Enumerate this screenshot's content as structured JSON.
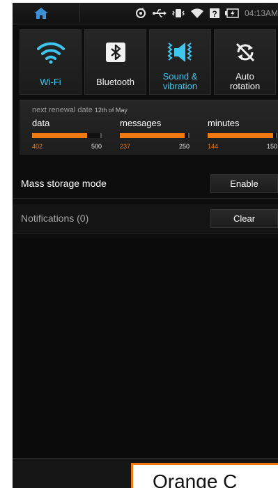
{
  "status_bar": {
    "time": "04:13AM",
    "icons": [
      "home-icon",
      "sync-icon",
      "usb-icon",
      "vibrate-icon",
      "wifi-signal-icon",
      "unknown-network-icon",
      "battery-icon"
    ]
  },
  "quick_settings": [
    {
      "label": "Wi-Fi",
      "icon": "wifi-icon",
      "active": true
    },
    {
      "label": "Bluetooth",
      "icon": "bluetooth-icon",
      "active": false
    },
    {
      "label": "Sound &\nvibration",
      "icon": "speaker-icon",
      "active": true
    },
    {
      "label": "Auto\nrotation",
      "icon": "rotation-icon",
      "active": false
    }
  ],
  "usage": {
    "renewal_label": "next renewal date",
    "renewal_date": "12th of May",
    "meters": [
      {
        "title": "data",
        "used": "402",
        "total": "500",
        "fraction": 0.804
      },
      {
        "title": "messages",
        "used": "237",
        "total": "250",
        "fraction": 0.948
      },
      {
        "title": "minutes",
        "used": "144",
        "total": "150",
        "fraction": 0.96
      }
    ]
  },
  "mass_storage": {
    "label": "Mass storage mode",
    "button": "Enable"
  },
  "notifications": {
    "label": "Notifications (0)",
    "button": "Clear"
  },
  "caption": {
    "text": "Orange C"
  },
  "colors": {
    "accent_blue": "#3fc6ee",
    "accent_orange": "#f07a12",
    "background": "#0d0d0d"
  }
}
